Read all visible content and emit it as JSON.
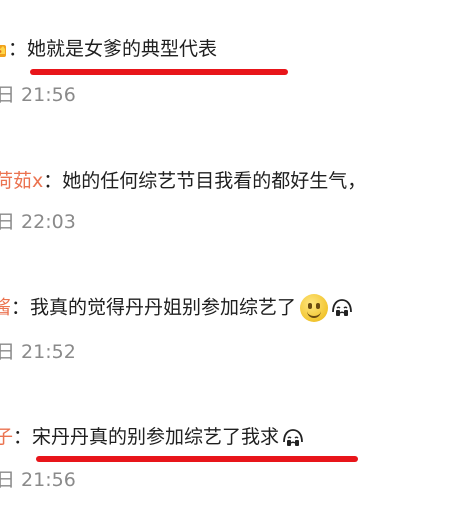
{
  "comments": [
    {
      "name": "",
      "separator": "：",
      "text": "她就是女爹的典型代表",
      "time": "日 21:56",
      "badge_icon": "crown-icon",
      "underline": true
    },
    {
      "name": "荷茹x",
      "separator": "：",
      "text": "她的任何综艺节目我看的都好生气，",
      "time": "日 22:03",
      "underline": false
    },
    {
      "name": "酱",
      "separator": "：",
      "text": "我真的觉得丹丹姐别参加综艺了",
      "time": "日 21:52",
      "emojis": [
        "smile-icon",
        "crying-face-icon"
      ],
      "underline": false
    },
    {
      "name": "子",
      "separator": "：",
      "text": "宋丹丹真的别参加综艺了我求",
      "time": "日 21:56",
      "emojis": [
        "crying-face-icon"
      ],
      "underline": true
    }
  ],
  "colors": {
    "username": "#eb7350",
    "text": "#1f1f1f",
    "timestamp": "#8a8a8a",
    "highlight_underline": "#e8151a"
  }
}
